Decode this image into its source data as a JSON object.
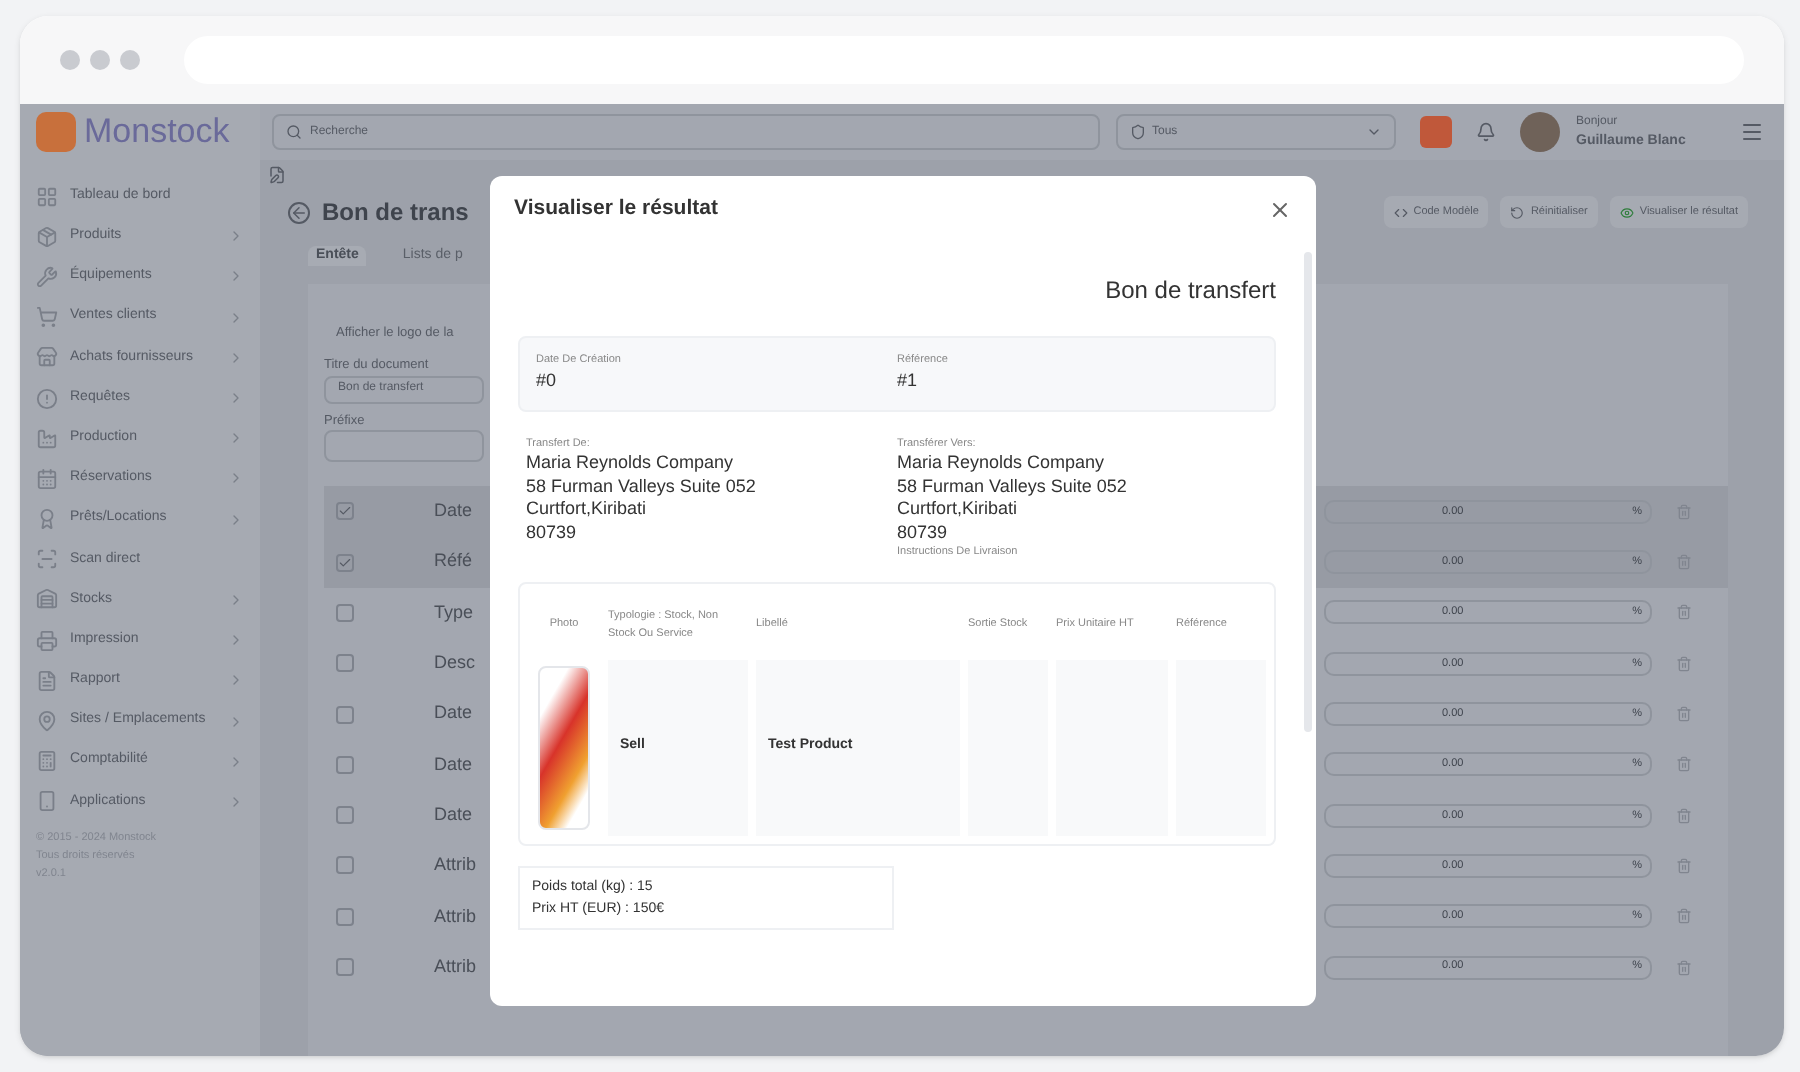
{
  "brand": {
    "name": "Monstock"
  },
  "header": {
    "search_placeholder": "Recherche",
    "filter": "Tous",
    "greeting": "Bonjour",
    "user": "Guillaume Blanc"
  },
  "sidebar": {
    "items": [
      {
        "label": "Tableau de bord",
        "submenu": false
      },
      {
        "label": "Produits",
        "submenu": true
      },
      {
        "label": "Équipements",
        "submenu": true
      },
      {
        "label": "Ventes clients",
        "submenu": true
      },
      {
        "label": "Achats fournisseurs",
        "submenu": true
      },
      {
        "label": "Requêtes",
        "submenu": true
      },
      {
        "label": "Production",
        "submenu": true
      },
      {
        "label": "Réservations",
        "submenu": true
      },
      {
        "label": "Prêts/Locations",
        "submenu": true
      },
      {
        "label": "Scan direct",
        "submenu": false
      },
      {
        "label": "Stocks",
        "submenu": true
      },
      {
        "label": "Impression",
        "submenu": true
      },
      {
        "label": "Rapport",
        "submenu": true
      },
      {
        "label": "Sites / Emplacements",
        "submenu": true
      },
      {
        "label": "Comptabilité",
        "submenu": true
      },
      {
        "label": "Applications",
        "submenu": true
      }
    ],
    "footer": [
      "© 2015 - 2024 Monstock",
      "Tous droits réservés",
      "v2.0.1"
    ]
  },
  "page": {
    "title": "Bon de trans",
    "actions": [
      "Code Modèle",
      "Réinitialiser",
      "Visualiser le résultat"
    ],
    "tabs": [
      {
        "label": "Entête",
        "selected": true
      },
      {
        "label": "Lists de p",
        "selected": false
      }
    ],
    "logo_option": "Afficher le logo de la",
    "document_title_label": "Titre du document",
    "document_title_value": "Bon de transfert",
    "prefix_label": "Préfixe",
    "rows": [
      {
        "label": "Date",
        "checked": true,
        "value": "0.00",
        "unit": "%"
      },
      {
        "label": "Réfé",
        "checked": true,
        "value": "0.00",
        "unit": "%"
      },
      {
        "label": "Type",
        "checked": false,
        "value": "0.00",
        "unit": "%"
      },
      {
        "label": "Desc",
        "checked": false,
        "value": "0.00",
        "unit": "%"
      },
      {
        "label": "Date",
        "checked": false,
        "value": "0.00",
        "unit": "%"
      },
      {
        "label": "Date",
        "checked": false,
        "value": "0.00",
        "unit": "%"
      },
      {
        "label": "Date",
        "checked": false,
        "value": "0.00",
        "unit": "%"
      },
      {
        "label": "Attrib",
        "checked": false,
        "value": "0.00",
        "unit": "%"
      },
      {
        "label": "Attrib",
        "checked": false,
        "value": "0.00",
        "unit": "%"
      },
      {
        "label": "Attrib",
        "checked": false,
        "value": "0.00",
        "unit": "%"
      }
    ]
  },
  "modal": {
    "title": "Visualiser le résultat",
    "doc_title": "Bon de transfert",
    "info": [
      {
        "label": "Date De Création",
        "value": "#0"
      },
      {
        "label": "Référence",
        "value": "#1"
      }
    ],
    "addresses": [
      {
        "label": "Transfert De:",
        "lines": [
          "Maria Reynolds Company",
          "58 Furman Valleys Suite 052",
          "Curtfort,Kiribati",
          "80739"
        ]
      },
      {
        "label": "Transférer Vers:",
        "lines": [
          "Maria Reynolds Company",
          "58 Furman Valleys Suite 052",
          "Curtfort,Kiribati",
          "80739"
        ],
        "note": "Instructions De Livraison"
      }
    ],
    "table": {
      "columns": [
        "Photo",
        "Typologie : Stock, Non Stock Ou Service",
        "Libellé",
        "Sortie Stock",
        "Prix Unitaire HT",
        "Référence"
      ],
      "rows": [
        [
          "",
          "Sell",
          "Test Product",
          "",
          "",
          ""
        ]
      ]
    },
    "totals": [
      "Poids total (kg) : 15",
      "Prix HT (EUR) : 150€"
    ]
  }
}
